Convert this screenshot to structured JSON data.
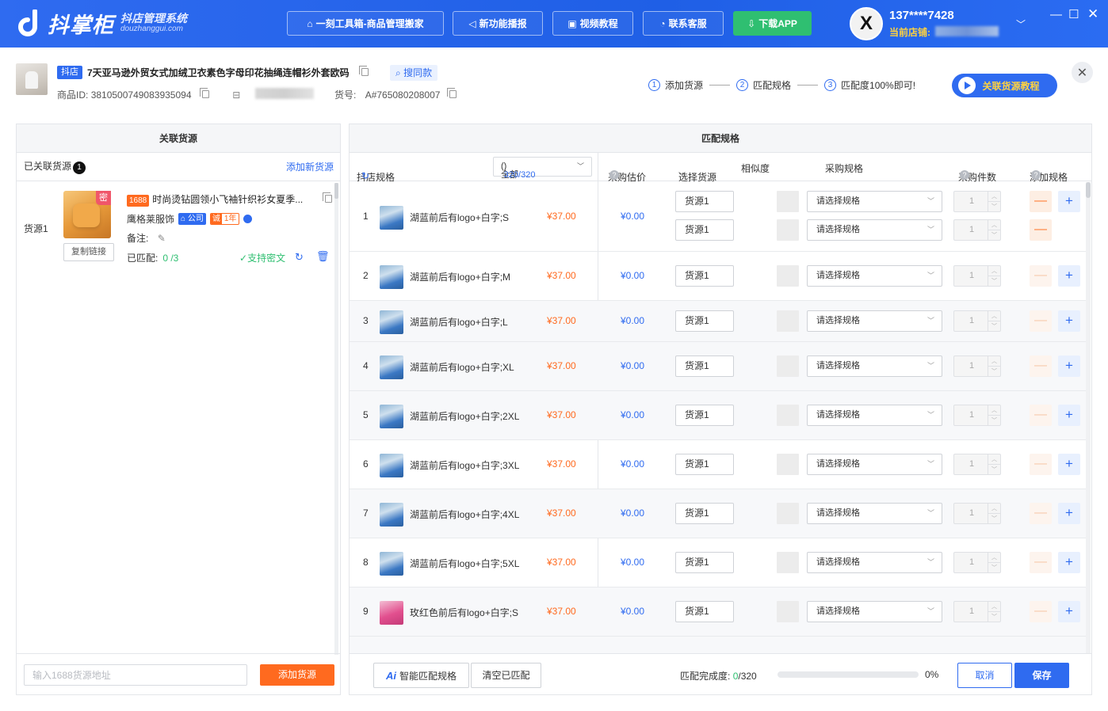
{
  "header": {
    "logo_text": "抖掌柜",
    "logo_sub": "抖店管理系统",
    "logo_domain": "douzhanggui.com",
    "buttons": [
      {
        "label": "一刻工具箱-商品管理搬家",
        "icon": "toolbox-icon"
      },
      {
        "label": "新功能播报",
        "icon": "megaphone-icon"
      },
      {
        "label": "视频教程",
        "icon": "video-icon"
      },
      {
        "label": "联系客服",
        "icon": "headset-icon"
      },
      {
        "label": "下载APP",
        "icon": "download-icon"
      }
    ],
    "user": {
      "avatar_letter": "X",
      "phone": "137****7428",
      "shop_label": "当前店铺:"
    }
  },
  "product": {
    "platform_tag": "抖店",
    "title": "7天亚马逊外贸女式加绒卫衣素色字母印花抽绳连帽衫外套欧码",
    "search_same": "搜同款",
    "id_label": "商品ID:",
    "id": "3810500749083935094",
    "sku_label": "货号:",
    "sku": "A#765080208007"
  },
  "steps": [
    {
      "num": "1",
      "label": "添加货源"
    },
    {
      "num": "2",
      "label": "匹配规格"
    },
    {
      "num": "3",
      "label": "匹配度100%即可!"
    }
  ],
  "tutorial_button": "关联货源教程",
  "left_panel": {
    "title": "关联货源",
    "linked_label": "已关联货源",
    "linked_count": "1",
    "add_new": "添加新货源",
    "source": {
      "label": "货源1",
      "secret_tag": "密",
      "copy_link": "复制链接",
      "tag_1688": "1688",
      "title": "时尚烫钻圆领小飞袖针织衫女夏季...",
      "shop": "鹰格莱服饰",
      "company_tag": "公司",
      "cheng_tag": "诚",
      "years_tag": "1年",
      "remark_label": "备注:",
      "matched_label": "已匹配:",
      "matched_value": "0 /3",
      "support": "支持密文"
    },
    "input_placeholder": "输入1688货源地址",
    "add_button": "添加货源"
  },
  "right_panel": {
    "title": "匹配规格",
    "columns": {
      "shop_spec": "抖店规格",
      "filter": "全部",
      "filter_count": "320/320",
      "est_price": "采购估价",
      "choose_source": "选择货源",
      "similarity": "相似度",
      "purchase_spec": "采购规格",
      "purchase_qty": "采购件数",
      "add_spec": "添加规格"
    },
    "rows": [
      {
        "idx": "1",
        "name": "湖蓝前后有logo+白字;S",
        "price": "¥37.00",
        "est": "¥0.00",
        "color": "blue",
        "subs": [
          {
            "source": "货源1",
            "spec": "请选择规格",
            "qty": "1"
          },
          {
            "source": "货源1",
            "spec": "请选择规格",
            "qty": "1"
          }
        ]
      },
      {
        "idx": "2",
        "name": "湖蓝前后有logo+白字;M",
        "price": "¥37.00",
        "est": "¥0.00",
        "color": "blue",
        "subs": [
          {
            "source": "货源1",
            "spec": "请选择规格",
            "qty": "1"
          }
        ]
      },
      {
        "idx": "3",
        "name": "湖蓝前后有logo+白字;L",
        "price": "¥37.00",
        "est": "¥0.00",
        "color": "blue",
        "subs": [
          {
            "source": "货源1",
            "spec": "请选择规格",
            "qty": "1"
          }
        ]
      },
      {
        "idx": "4",
        "name": "湖蓝前后有logo+白字;XL",
        "price": "¥37.00",
        "est": "¥0.00",
        "color": "blue",
        "subs": [
          {
            "source": "货源1",
            "spec": "请选择规格",
            "qty": "1"
          }
        ]
      },
      {
        "idx": "5",
        "name": "湖蓝前后有logo+白字;2XL",
        "price": "¥37.00",
        "est": "¥0.00",
        "color": "blue",
        "subs": [
          {
            "source": "货源1",
            "spec": "请选择规格",
            "qty": "1"
          }
        ]
      },
      {
        "idx": "6",
        "name": "湖蓝前后有logo+白字;3XL",
        "price": "¥37.00",
        "est": "¥0.00",
        "color": "blue",
        "subs": [
          {
            "source": "货源1",
            "spec": "请选择规格",
            "qty": "1"
          }
        ]
      },
      {
        "idx": "7",
        "name": "湖蓝前后有logo+白字;4XL",
        "price": "¥37.00",
        "est": "¥0.00",
        "color": "blue",
        "subs": [
          {
            "source": "货源1",
            "spec": "请选择规格",
            "qty": "1"
          }
        ]
      },
      {
        "idx": "8",
        "name": "湖蓝前后有logo+白字;5XL",
        "price": "¥37.00",
        "est": "¥0.00",
        "color": "blue",
        "subs": [
          {
            "source": "货源1",
            "spec": "请选择规格",
            "qty": "1"
          }
        ]
      },
      {
        "idx": "9",
        "name": "玫红色前后有logo+白字;S",
        "price": "¥37.00",
        "est": "¥0.00",
        "color": "pink",
        "subs": [
          {
            "source": "货源1",
            "spec": "请选择规格",
            "qty": "1"
          }
        ]
      }
    ],
    "ai_button": "智能匹配规格",
    "clear_button": "清空已匹配",
    "progress_label": "匹配完成度:",
    "progress_done": "0",
    "progress_total": "/320",
    "progress_fraction": 0,
    "progress_pct": "0%",
    "cancel": "取消",
    "save": "保存"
  },
  "colors": {
    "brand_blue": "#2f6bf0",
    "orange": "#ff6a1f",
    "green": "#2fbf71"
  }
}
